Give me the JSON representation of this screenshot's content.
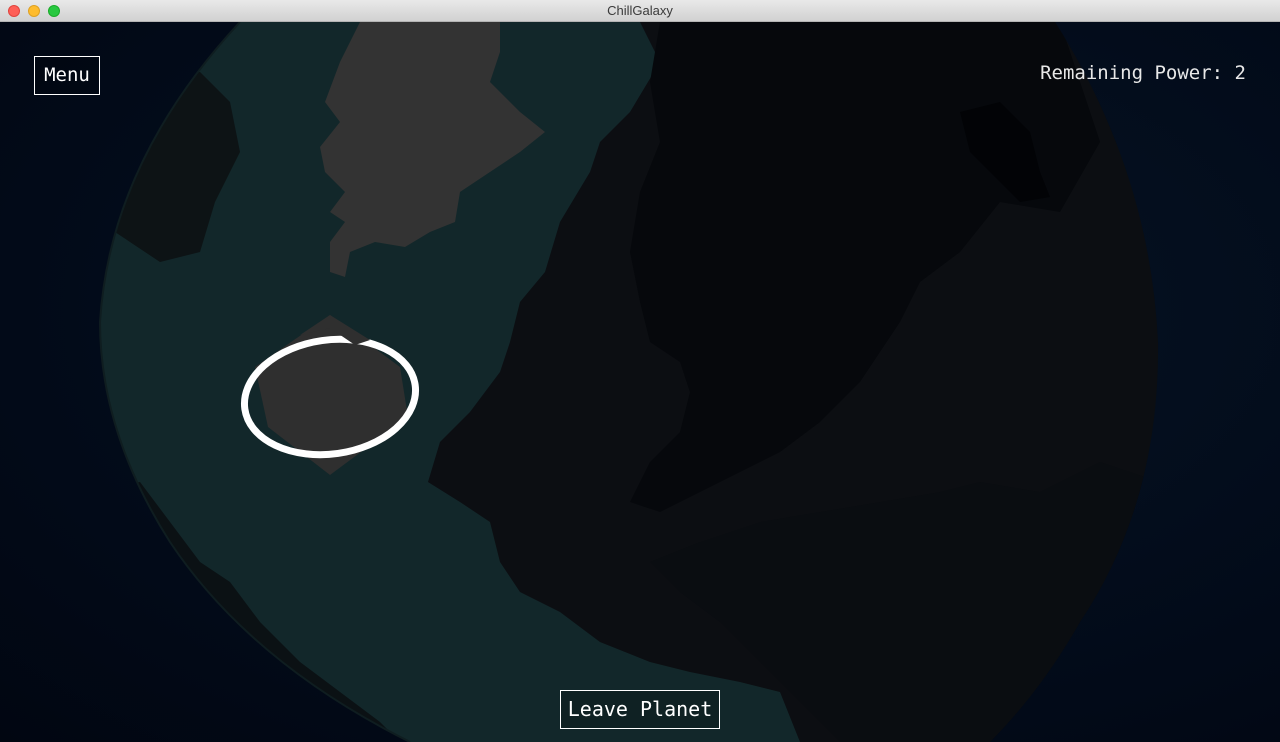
{
  "window": {
    "title": "ChillGalaxy"
  },
  "hud": {
    "menu_label": "Menu",
    "leave_planet_label": "Leave Planet",
    "remaining_power_label": "Remaining Power:",
    "remaining_power_value": "2"
  },
  "colors": {
    "space": "#020a18",
    "planet_dark": "#0b0e12",
    "planet_teal": "#12272a",
    "planet_grey": "#333333",
    "selection_ring": "#ffffff"
  }
}
